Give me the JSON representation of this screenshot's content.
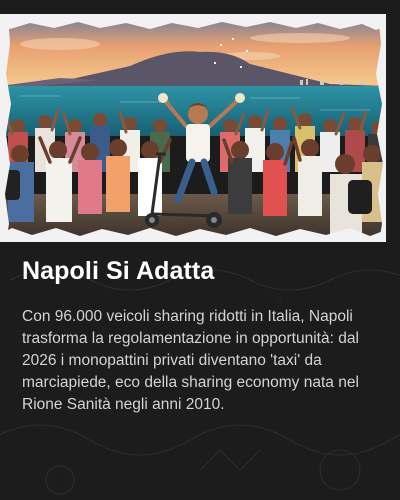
{
  "article": {
    "title": "Napoli Si Adatta",
    "body": "Con 96.000 veicoli sharing ridotti in Italia, Napoli trasforma la regolamentazione in opportunità: dal 2026 i monopattini privati diventano 'taxi' da marciapiede, eco della sharing economy nata nel Rione Sanità negli anni 2010."
  },
  "image": {
    "subject": "crowd-celebrating-rider-on-electric-scooter-at-naples-waterfront-with-vesuvius",
    "sky_color": "#f0b070",
    "sea_color": "#1e7f96"
  },
  "colors": {
    "background": "#1c1c1c",
    "title": "#ffffff",
    "body": "#d4d4d4"
  }
}
